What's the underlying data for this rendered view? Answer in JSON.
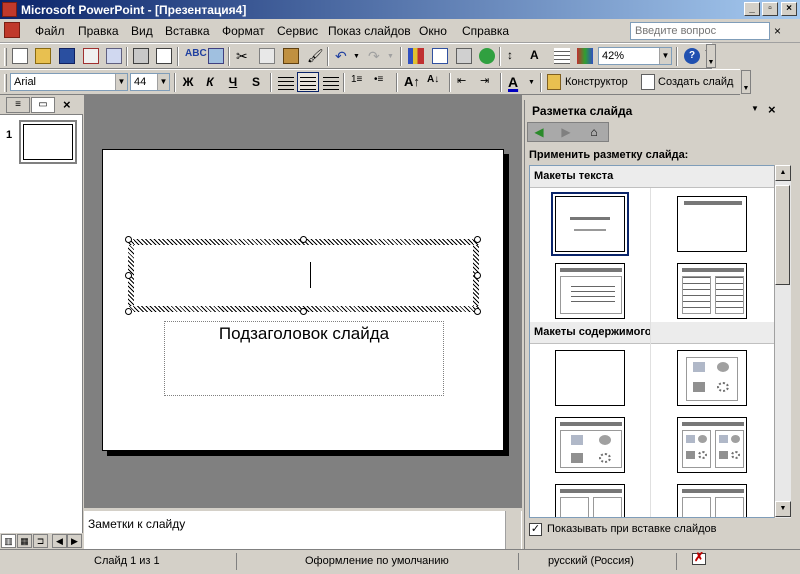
{
  "app": {
    "title": "Microsoft PowerPoint - [Презентация4]"
  },
  "window_buttons": [
    "_",
    "▫",
    "×"
  ],
  "menu": {
    "items": [
      "Файл",
      "Правка",
      "Вид",
      "Вставка",
      "Формат",
      "Сервис",
      "Показ слайдов",
      "Окно",
      "Справка"
    ],
    "help_placeholder": "Введите вопрос"
  },
  "standard_toolbar": {
    "zoom": "42%"
  },
  "formatting_toolbar": {
    "font": "Arial",
    "size": "44",
    "bold": "Ж",
    "italic": "К",
    "underline": "Ч",
    "shadow": "S",
    "designer_label": "Конструктор",
    "new_slide_label": "Создать слайд"
  },
  "slides_panel": {
    "slide_number": "1"
  },
  "slide": {
    "subtitle": "Подзаголовок слайда"
  },
  "notes": {
    "text": "Заметки к слайду"
  },
  "task_pane": {
    "title": "Разметка слайда",
    "apply_label": "Применить разметку слайда:",
    "section_text": "Макеты текста",
    "section_content": "Макеты содержимого",
    "show_on_insert": "Показывать при вставке слайдов",
    "show_on_insert_checked": true
  },
  "status": {
    "slide": "Слайд 1 из 1",
    "design": "Оформление по умолчанию",
    "language": "русский (Россия)"
  },
  "colors": {
    "titlebar_start": "#0a246a",
    "titlebar_end": "#a6caf0",
    "chrome": "#d4d0c8",
    "workspace": "#808080"
  }
}
